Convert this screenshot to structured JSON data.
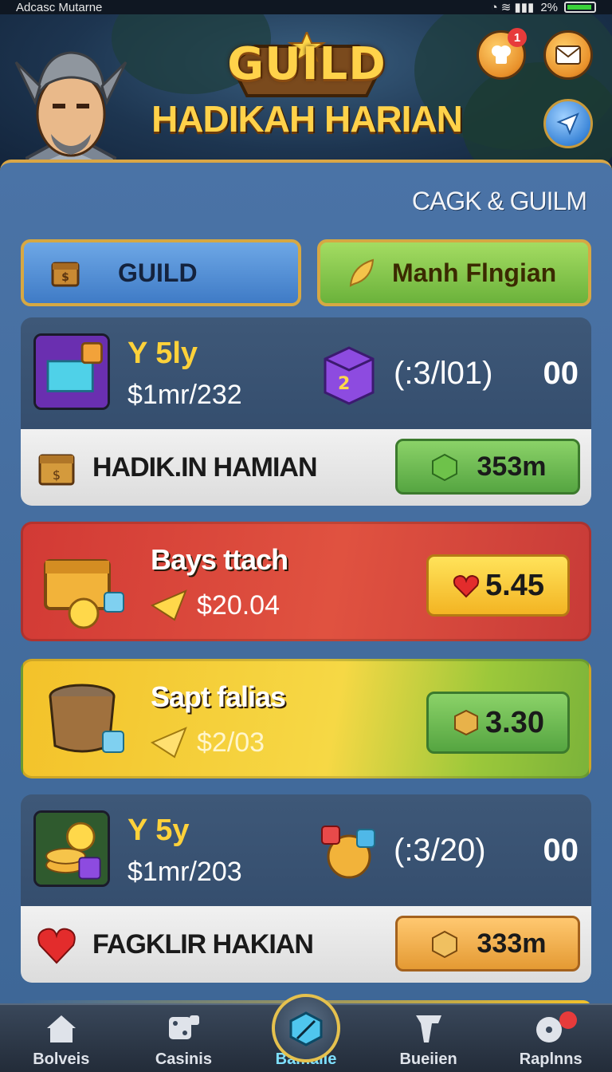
{
  "status_bar": {
    "left_text": "Adcasc Mutarne",
    "battery_text": "2%"
  },
  "header": {
    "logo_text": "GUILD",
    "subtitle": "HADIKAH HARIAN",
    "notification_count": "1"
  },
  "panel": {
    "guild_label": "CAGK & GUILM",
    "tabs": [
      {
        "label": "GUILD"
      },
      {
        "label": "Manh Flngian"
      }
    ]
  },
  "events": [
    {
      "title": "Y 5ly",
      "subtitle": "$1mr/232",
      "ratio": "(:3/l01)",
      "count": "00",
      "strip_label": "HADIK.IN HAMIAN",
      "button_value": "353m"
    },
    {
      "title": "Y 5y",
      "subtitle": "$1mr/203",
      "ratio": "(:3/20)",
      "count": "00",
      "strip_label": "FAGKLIR HAKIAN",
      "button_value": "333m"
    }
  ],
  "offers": [
    {
      "title": "Bays ttach",
      "price": "$20.04",
      "button_value": "5.45"
    },
    {
      "title": "Sapt falias",
      "price": "$2/03",
      "button_value": "3.30"
    }
  ],
  "nav": [
    {
      "label": "Bolveis"
    },
    {
      "label": "Casinis"
    },
    {
      "label": "Bamalle"
    },
    {
      "label": "Bueiien"
    },
    {
      "label": "Raplnns"
    }
  ],
  "colors": {
    "panel_blue": "#4a73a6",
    "gold_border": "#d6a843",
    "title_yellow": "#ffd23a",
    "offer_red": "#d23a35",
    "offer_yellow": "#f3c22a",
    "active_nav": "#7ee0ff"
  }
}
